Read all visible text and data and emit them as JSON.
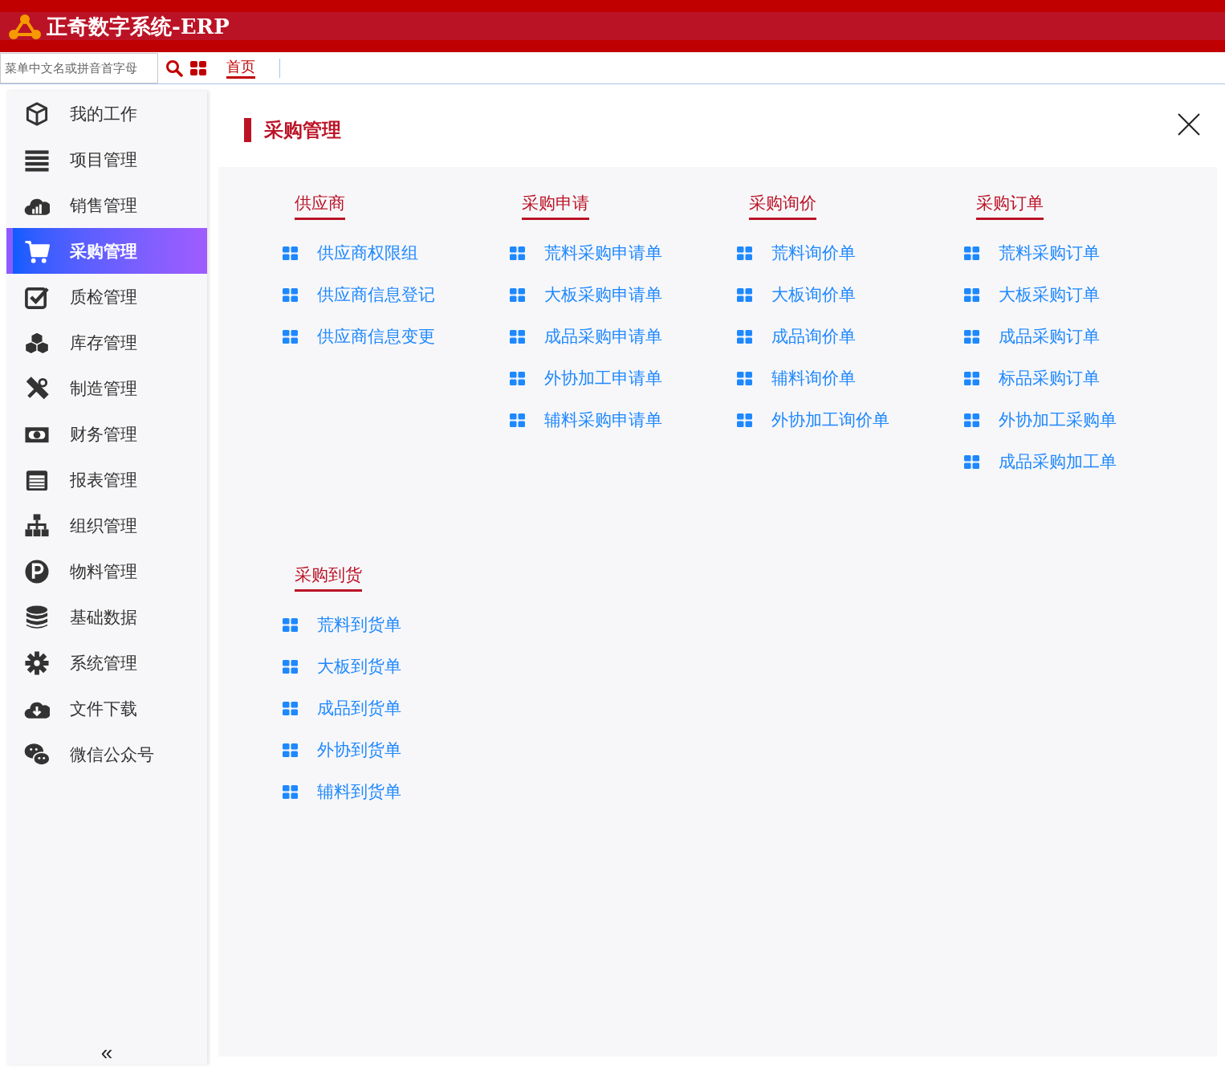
{
  "app": {
    "title": "正奇数字系统-ERP"
  },
  "toolbar": {
    "search": {
      "placeholder": "菜单中文名或拼音首字母"
    },
    "tabs": [
      {
        "label": "首页",
        "selected": true
      }
    ]
  },
  "sidebar": {
    "items": [
      {
        "label": "我的工作",
        "selected": false
      },
      {
        "label": "项目管理",
        "selected": false
      },
      {
        "label": "销售管理",
        "selected": false
      },
      {
        "label": "采购管理",
        "selected": true
      },
      {
        "label": "质检管理",
        "selected": false
      },
      {
        "label": "库存管理",
        "selected": false
      },
      {
        "label": "制造管理",
        "selected": false
      },
      {
        "label": "财务管理",
        "selected": false
      },
      {
        "label": "报表管理",
        "selected": false
      },
      {
        "label": "组织管理",
        "selected": false
      },
      {
        "label": "物料管理",
        "selected": false
      },
      {
        "label": "基础数据",
        "selected": false
      },
      {
        "label": "系统管理",
        "selected": false
      },
      {
        "label": "文件下载",
        "selected": false
      },
      {
        "label": "微信公众号",
        "selected": false
      }
    ],
    "collapse": "«"
  },
  "panel": {
    "title": "采购管理",
    "groups": [
      {
        "title": "供应商",
        "items": [
          "供应商权限组",
          "供应商信息登记",
          "供应商信息变更"
        ]
      },
      {
        "title": "采购申请",
        "items": [
          "荒料采购申请单",
          "大板采购申请单",
          "成品采购申请单",
          "外协加工申请单",
          "辅料采购申请单"
        ]
      },
      {
        "title": "采购询价",
        "items": [
          "荒料询价单",
          "大板询价单",
          "成品询价单",
          "辅料询价单",
          "外协加工询价单"
        ]
      },
      {
        "title": "采购订单",
        "items": [
          "荒料采购订单",
          "大板采购订单",
          "成品采购订单",
          "标品采购订单",
          "外协加工采购单",
          "成品采购加工单"
        ]
      },
      {
        "title": "采购到货",
        "items": [
          "荒料到货单",
          "大板到货单",
          "成品到货单",
          "外协到货单",
          "辅料到货单"
        ]
      }
    ]
  }
}
